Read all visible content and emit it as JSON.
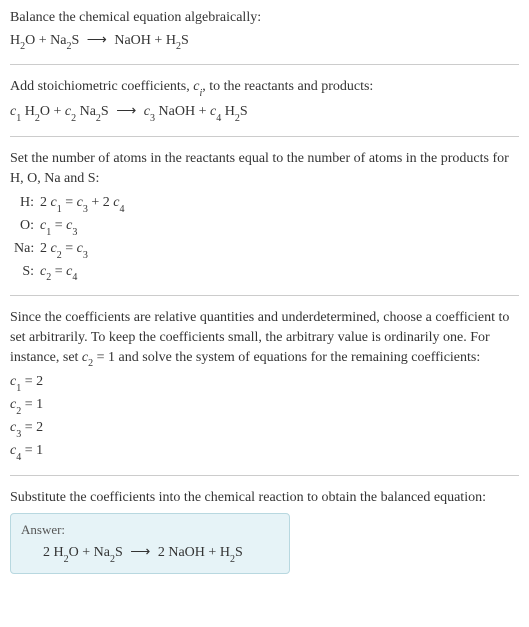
{
  "section1": {
    "title": "Balance the chemical equation algebraically:"
  },
  "section2": {
    "text": "Add stoichiometric coefficients, ",
    "cvar": "c",
    "csub": "i",
    "text2": ", to the reactants and products:"
  },
  "section3": {
    "text": "Set the number of atoms in the reactants equal to the number of atoms in the products for H, O, Na and S:",
    "rows": [
      {
        "label": "H:",
        "lhs_a": "2",
        "lhs_b": "1",
        "rhs_a": "",
        "rhs_b": "3",
        "rhs2_a": " + 2",
        "rhs2_b": "4"
      },
      {
        "label": "O:",
        "lhs_a": "",
        "lhs_b": "1",
        "rhs_a": "",
        "rhs_b": "3"
      },
      {
        "label": "Na:",
        "lhs_a": "2",
        "lhs_b": "2",
        "rhs_a": "",
        "rhs_b": "3"
      },
      {
        "label": "S:",
        "lhs_a": "",
        "lhs_b": "2",
        "rhs_a": "",
        "rhs_b": "4"
      }
    ]
  },
  "section4": {
    "text1": "Since the coefficients are relative quantities and underdetermined, choose a coefficient to set arbitrarily. To keep the coefficients small, the arbitrary value is ordinarily one. For instance, set ",
    "cvar": "c",
    "csub": "2",
    "text2": " = 1 and solve the system of equations for the remaining coefficients:",
    "coeffs": [
      {
        "sub": "1",
        "val": " = 2"
      },
      {
        "sub": "2",
        "val": " = 1"
      },
      {
        "sub": "3",
        "val": " = 2"
      },
      {
        "sub": "4",
        "val": " = 1"
      }
    ]
  },
  "section5": {
    "text": "Substitute the coefficients into the chemical reaction to obtain the balanced equation:"
  },
  "answer": {
    "label": "Answer:"
  },
  "chem": {
    "H": "H",
    "O": "O",
    "Na": "Na",
    "S": "S",
    "two": "2",
    "c": "c",
    "arrow": "⟶",
    "plus": " + ",
    "eq": " = ",
    "space": " ",
    "c1": "1",
    "c2": "2",
    "c3": "3",
    "c4": "4",
    "NaOH": "NaOH"
  }
}
